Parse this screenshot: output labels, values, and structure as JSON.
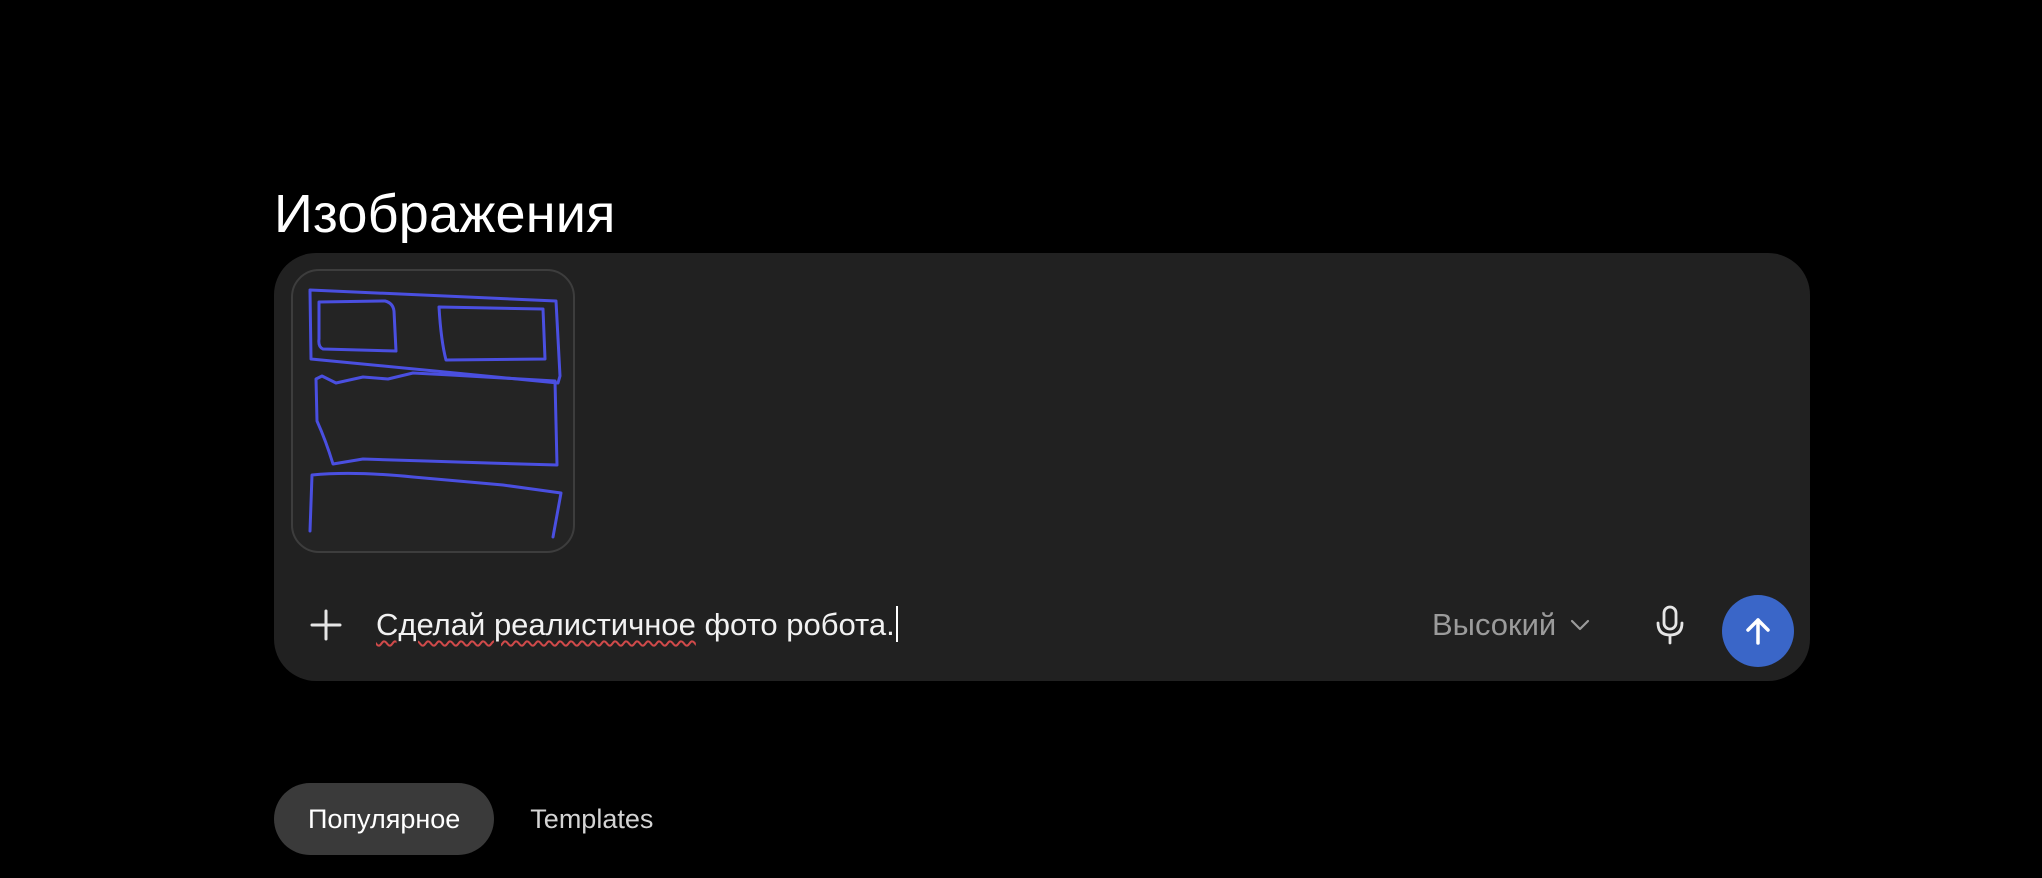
{
  "page": {
    "title": "Изображения"
  },
  "composer": {
    "attachment": {
      "icon": "sketch-thumbnail",
      "stroke_color": "#4a4fe0"
    },
    "add_button": {
      "icon": "plus-icon"
    },
    "prompt": {
      "misspelled": "Сделай реалистичное",
      "rest": " фото робота."
    },
    "quality": {
      "selected": "Высокий",
      "icon": "chevron-down-icon"
    },
    "mic_button": {
      "icon": "microphone-icon"
    },
    "send_button": {
      "icon": "arrow-up-icon",
      "color": "#3a66c8"
    }
  },
  "tabs": [
    {
      "label": "Популярное",
      "active": true
    },
    {
      "label": "Templates",
      "active": false
    }
  ]
}
